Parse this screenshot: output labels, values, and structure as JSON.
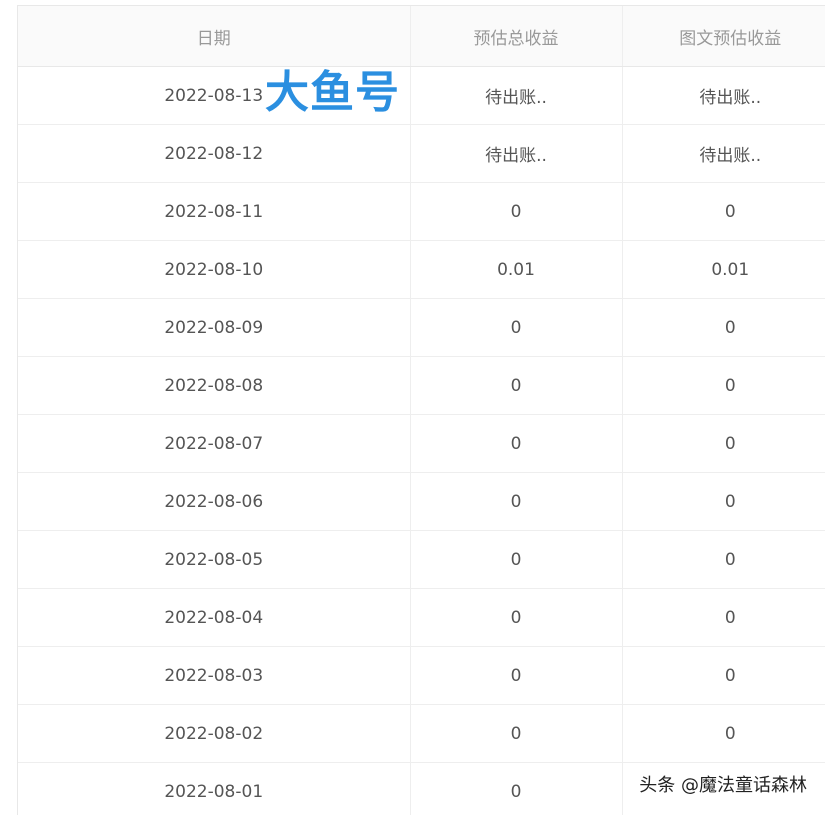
{
  "table": {
    "headers": {
      "date": "日期",
      "total": "预估总收益",
      "graphic": "图文预估收益"
    },
    "rows": [
      {
        "date": "2022-08-13",
        "total": "待出账..",
        "graphic": "待出账.."
      },
      {
        "date": "2022-08-12",
        "total": "待出账..",
        "graphic": "待出账.."
      },
      {
        "date": "2022-08-11",
        "total": "0",
        "graphic": "0"
      },
      {
        "date": "2022-08-10",
        "total": "0.01",
        "graphic": "0.01"
      },
      {
        "date": "2022-08-09",
        "total": "0",
        "graphic": "0"
      },
      {
        "date": "2022-08-08",
        "total": "0",
        "graphic": "0"
      },
      {
        "date": "2022-08-07",
        "total": "0",
        "graphic": "0"
      },
      {
        "date": "2022-08-06",
        "total": "0",
        "graphic": "0"
      },
      {
        "date": "2022-08-05",
        "total": "0",
        "graphic": "0"
      },
      {
        "date": "2022-08-04",
        "total": "0",
        "graphic": "0"
      },
      {
        "date": "2022-08-03",
        "total": "0",
        "graphic": "0"
      },
      {
        "date": "2022-08-02",
        "total": "0",
        "graphic": "0"
      },
      {
        "date": "2022-08-01",
        "total": "0",
        "graphic": ""
      }
    ]
  },
  "overlays": {
    "top_text": "大鱼号",
    "bottom_text": "头条 @魔法童话森林"
  },
  "colors": {
    "top_text": "#2b8fe0",
    "header_bg": "#fafafa",
    "header_text": "#999999",
    "cell_text": "#555555",
    "border": "#e8e8e8"
  }
}
